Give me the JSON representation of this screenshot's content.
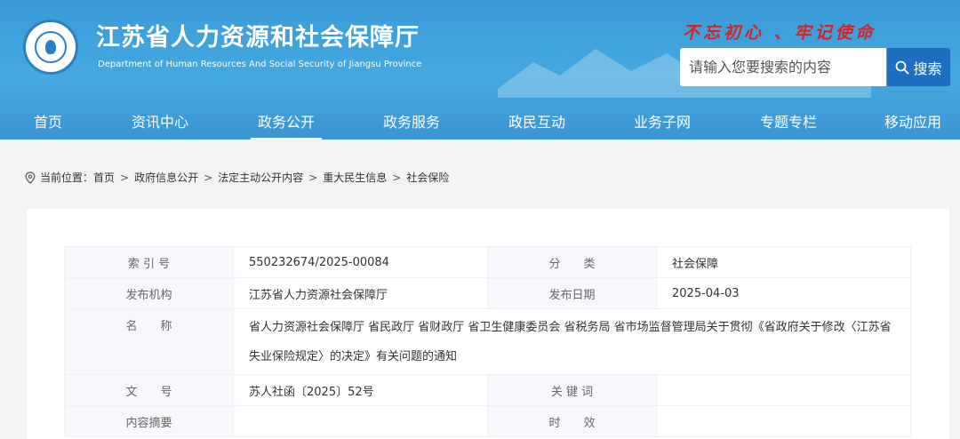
{
  "header": {
    "title": "江苏省人力资源和社会保障厅",
    "subtitle": "Department of Human Resources And Social Security of Jiangsu Province",
    "slogan": "不忘初心 、牢记使命",
    "logo_icon": "emblem-icon",
    "colors": {
      "banner": "#3a9bd9",
      "slogan": "#d42323",
      "search_button": "#1f6fc0"
    }
  },
  "search": {
    "placeholder": "请输入您要搜索的内容",
    "button_label": "搜索",
    "icon": "search-icon"
  },
  "nav": {
    "items": [
      {
        "label": "首页"
      },
      {
        "label": "资讯中心"
      },
      {
        "label": "政务公开"
      },
      {
        "label": "政务服务"
      },
      {
        "label": "政民互动"
      },
      {
        "label": "业务子网"
      },
      {
        "label": "专题专栏"
      },
      {
        "label": "移动应用"
      }
    ],
    "active": "政务公开"
  },
  "breadcrumb": {
    "icon": "location-pin-icon",
    "prefix": "当前位置：",
    "items": [
      "首页",
      "政府信息公开",
      "法定主动公开内容",
      "重大民生信息",
      "社会保险"
    ],
    "separator": ">"
  },
  "info": {
    "index_label": "索 引 号",
    "index_value": "550232674/2025-00084",
    "category_label": "分　　类",
    "category_value": "社会保障",
    "publisher_label": "发布机构",
    "publisher_value": "江苏省人力资源社会保障厅",
    "date_label": "发布日期",
    "date_value": "2025-04-03",
    "name_label": "名　　称",
    "name_value": "省人力资源社会保障厅 省民政厅 省财政厅 省卫生健康委员会 省税务局 省市场监督管理局关于贯彻《省政府关于修改〈江苏省失业保险规定〉的决定》有关问题的通知",
    "docno_label": "文　　号",
    "docno_value": "苏人社函〔2025〕52号",
    "keywords_label": "关 键 词",
    "keywords_value": "",
    "abstract_label": "内容摘要",
    "abstract_value": "",
    "validity_label": "时　　效",
    "validity_value": ""
  }
}
